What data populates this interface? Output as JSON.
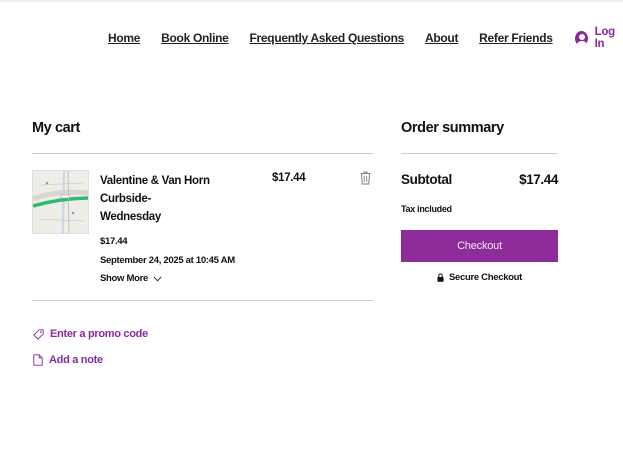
{
  "nav": {
    "items": [
      "Home",
      "Book Online",
      "Frequently Asked Questions",
      "About",
      "Refer Friends"
    ],
    "login": "Log In",
    "login_icon": "user-avatar-icon"
  },
  "cart": {
    "heading": "My cart",
    "item": {
      "name": "Valentine & Van Horn Curbside-Wednesday",
      "price": "$17.44",
      "unit_price": "$17.44",
      "date": "September 24, 2025 at 10:45 AM",
      "show_more": "Show More",
      "thumbnail_icon": "map-thumbnail",
      "remove_icon": "trash-icon"
    },
    "promo": "Enter a promo code",
    "note": "Add a note"
  },
  "summary": {
    "heading": "Order summary",
    "subtotal_label": "Subtotal",
    "subtotal_value": "$17.44",
    "tax_note": "Tax included",
    "checkout": "Checkout",
    "secure": "Secure Checkout"
  },
  "colors": {
    "accent": "#8e2c9b",
    "link": "#8a2aa0",
    "divider": "#cfcfcf"
  }
}
